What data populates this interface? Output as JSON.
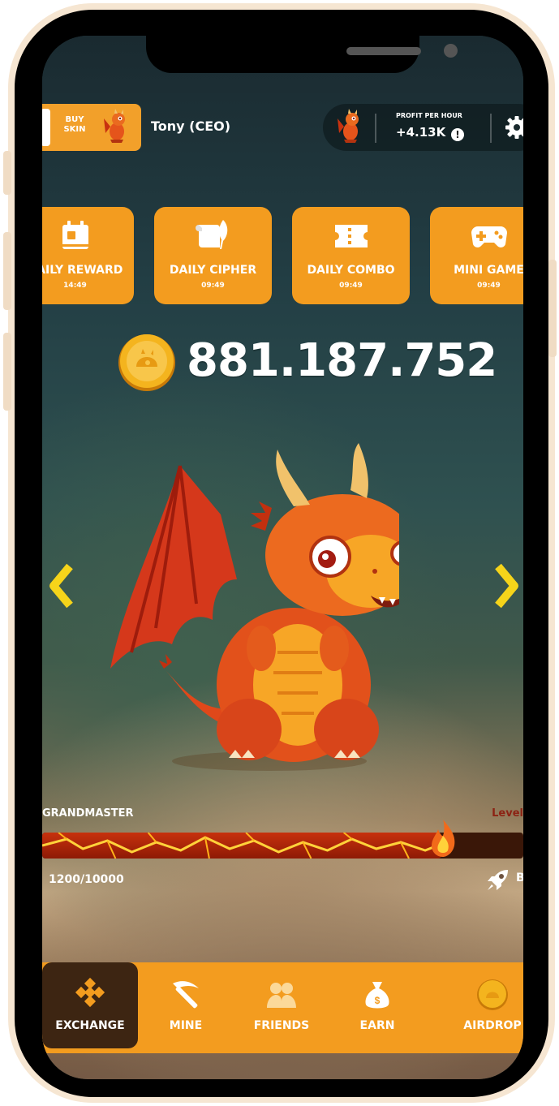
{
  "topbar": {
    "buy_skin": "BUY SKIN",
    "username": "Tony (CEO)",
    "profit_title": "PROFIT PER HOUR",
    "profit_value": "+4.13K",
    "info": "!"
  },
  "tiles": [
    {
      "label": "DAILY REWARD",
      "time": "14:49"
    },
    {
      "label": "DAILY CIPHER",
      "time": "09:49"
    },
    {
      "label": "DAILY COMBO",
      "time": "09:49"
    },
    {
      "label": "MINI GAME",
      "time": "09:49"
    }
  ],
  "balance": "881.187.752",
  "level": {
    "name": "GRANDMASTER",
    "label": "Level",
    "progress_text": "1200/10000",
    "progress_fraction": 0.12,
    "boost_label": "Boost"
  },
  "nav": [
    {
      "label": "EXCHANGE",
      "icon": "exchange-icon"
    },
    {
      "label": "MINE",
      "icon": "pickaxe-icon"
    },
    {
      "label": "FRIENDS",
      "icon": "friends-icon"
    },
    {
      "label": "EARN",
      "icon": "money-bag-icon"
    },
    {
      "label": "AIRDROP",
      "icon": "coin-icon"
    }
  ],
  "colors": {
    "accent": "#f39c1f",
    "nav_active": "#3d2512",
    "text": "#ffffff"
  }
}
